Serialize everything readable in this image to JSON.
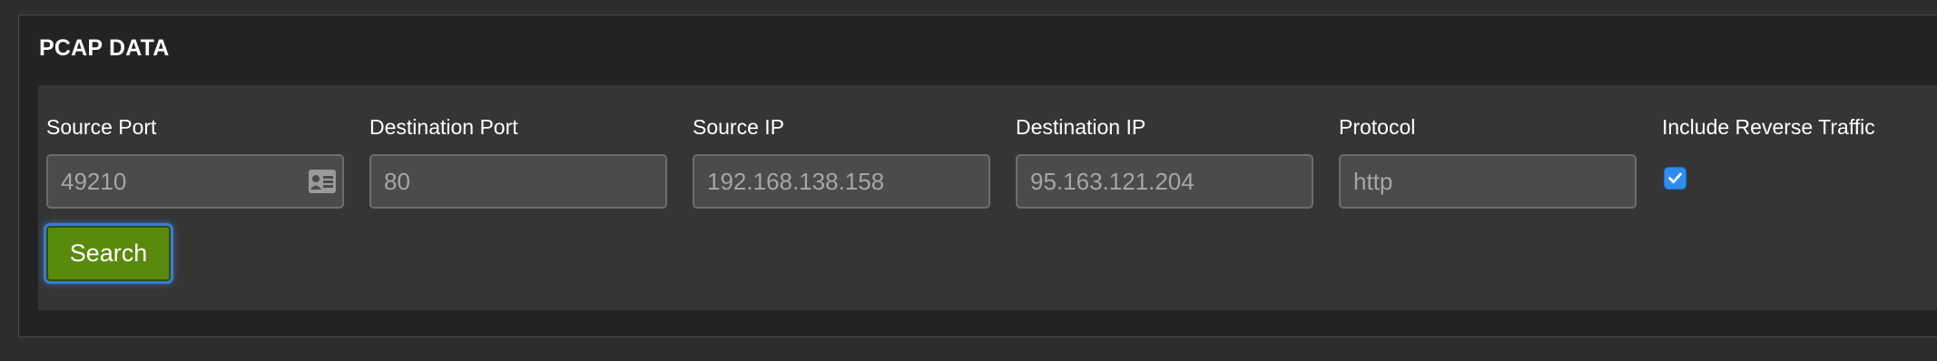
{
  "panel": {
    "title": "PCAP DATA"
  },
  "fields": {
    "source_port": {
      "label": "Source Port",
      "value": "49210",
      "icon": "contact-card-icon"
    },
    "destination_port": {
      "label": "Destination Port",
      "value": "80"
    },
    "source_ip": {
      "label": "Source IP",
      "value": "192.168.138.158"
    },
    "destination_ip": {
      "label": "Destination IP",
      "value": "95.163.121.204"
    },
    "protocol": {
      "label": "Protocol",
      "value": "http"
    },
    "include_reverse": {
      "label": "Include Reverse Traffic",
      "checked": true
    }
  },
  "search_button": {
    "label": "Search"
  },
  "colors": {
    "page_bg": "#2d2d2d",
    "panel_bg": "#232323",
    "form_bg": "#353535",
    "input_bg": "#4b4b4b",
    "button_green": "#5a8a0b",
    "checkbox_blue": "#2d8cf0"
  }
}
